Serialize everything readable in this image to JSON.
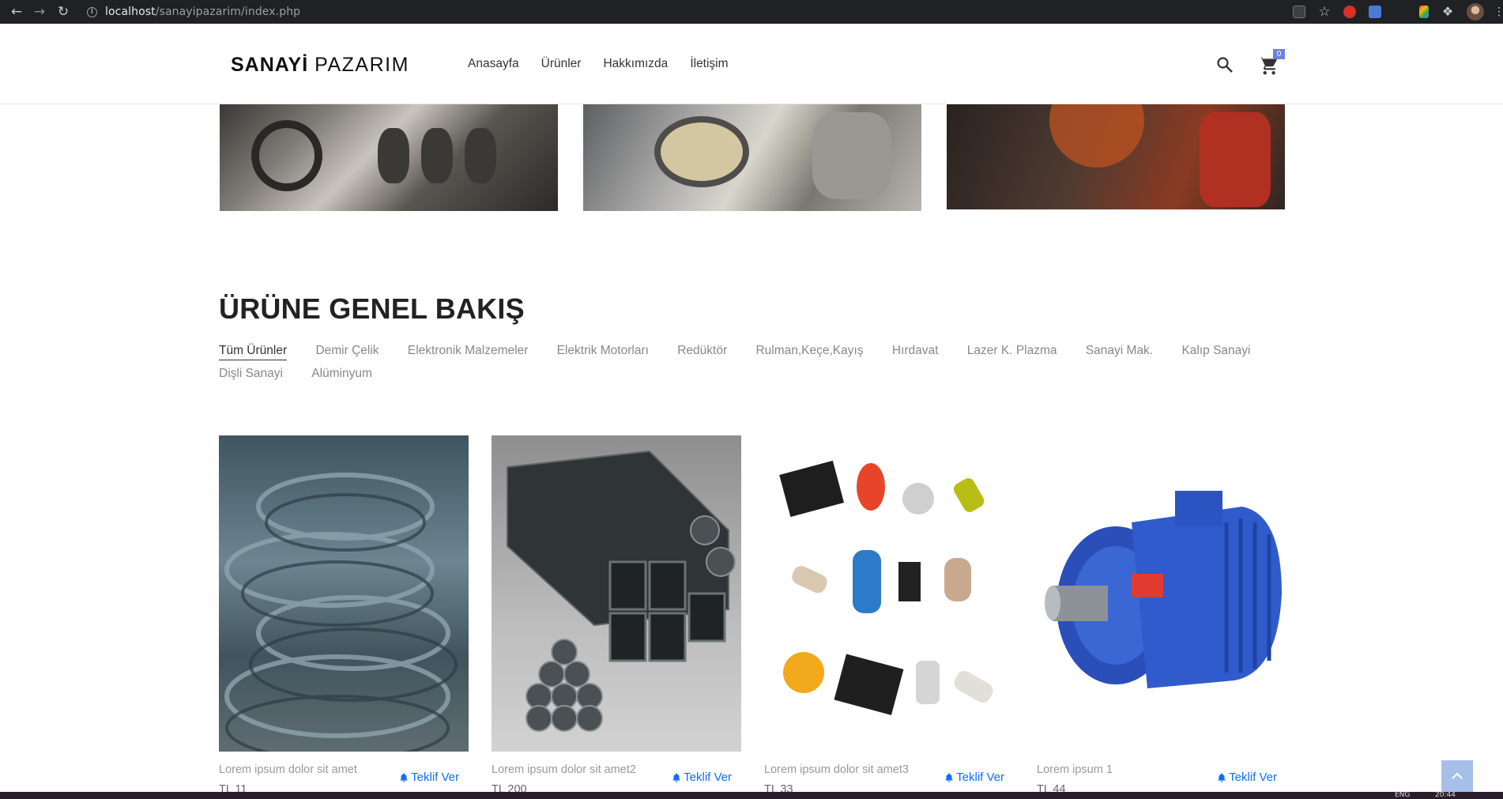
{
  "browser": {
    "url_host": "localhost",
    "url_path": "/sanayipazarim/index.php"
  },
  "site": {
    "logo_bold": "SANAYİ",
    "logo_light": "PAZARIM",
    "nav": [
      "Anasayfa",
      "Ürünler",
      "Hakkımızda",
      "İletişim"
    ],
    "cart_count": "0"
  },
  "section": {
    "title": "ÜRÜNE GENEL BAKIŞ",
    "filters_row1": [
      "Tüm Ürünler",
      "Demir Çelik",
      "Elektronik Malzemeler",
      "Elektrik Motorları",
      "Redüktör",
      "Rulman,Keçe,Kayış",
      "Hırdavat",
      "Lazer K. Plazma",
      "Sanayi Mak.",
      "Kalıp Sanayi"
    ],
    "filters_row2": [
      "Dişli Sanayi",
      "Alüminyum"
    ],
    "active_filter": "Tüm Ürünler"
  },
  "products": [
    {
      "name": "Lorem ipsum dolor sit amet",
      "price": "TL 11",
      "offer": "Teklif Ver"
    },
    {
      "name": "Lorem ipsum dolor sit amet2",
      "price": "TL 200",
      "offer": "Teklif Ver"
    },
    {
      "name": "Lorem ipsum dolor sit amet3",
      "price": "TL 33",
      "offer": "Teklif Ver"
    },
    {
      "name": "Lorem ipsum 1",
      "price": "TL 44",
      "offer": "Teklif Ver"
    }
  ],
  "taskbar": {
    "lang": "ENG",
    "time": "20:44"
  },
  "icons": {
    "search": "search-icon",
    "cart": "cart-icon",
    "bell": "bell-icon",
    "scroll_top": "chevron-up-icon"
  },
  "colors": {
    "badge": "#717fe0",
    "offer_link": "#0d6efd",
    "scroll_top": "#a5bfe8"
  }
}
